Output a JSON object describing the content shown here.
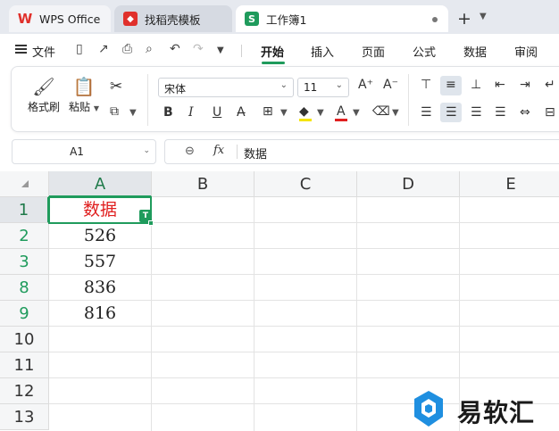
{
  "tabs": [
    {
      "label": "WPS Office",
      "icon": "wps-logo-icon"
    },
    {
      "label": "找稻壳模板",
      "icon": "docer-icon"
    },
    {
      "label": "工作簿1",
      "icon": "spreadsheet-icon",
      "icon_letter": "S"
    }
  ],
  "menu": {
    "file_label": "文件",
    "items": [
      "开始",
      "插入",
      "页面",
      "公式",
      "数据",
      "审阅"
    ],
    "active": "开始"
  },
  "ribbon": {
    "format_painter": "格式刷",
    "paste": "粘贴",
    "font_name": "宋体",
    "font_size": "11",
    "bold": "B",
    "italic": "I",
    "underline": "U"
  },
  "formula_bar": {
    "cell_ref": "A1",
    "fx": "fx",
    "content": "数据"
  },
  "grid": {
    "columns": [
      "A",
      "B",
      "C",
      "D",
      "E"
    ],
    "rows": [
      "1",
      "2",
      "3",
      "8",
      "9",
      "10",
      "11",
      "12",
      "13"
    ],
    "cells": [
      "数据",
      "526",
      "557",
      "836",
      "816"
    ],
    "selected_cell": "A1",
    "filter_tag": "T"
  },
  "watermark": {
    "text": "易软汇"
  },
  "colors": {
    "accent": "#1f9b5c",
    "header_text": "#e02020"
  }
}
